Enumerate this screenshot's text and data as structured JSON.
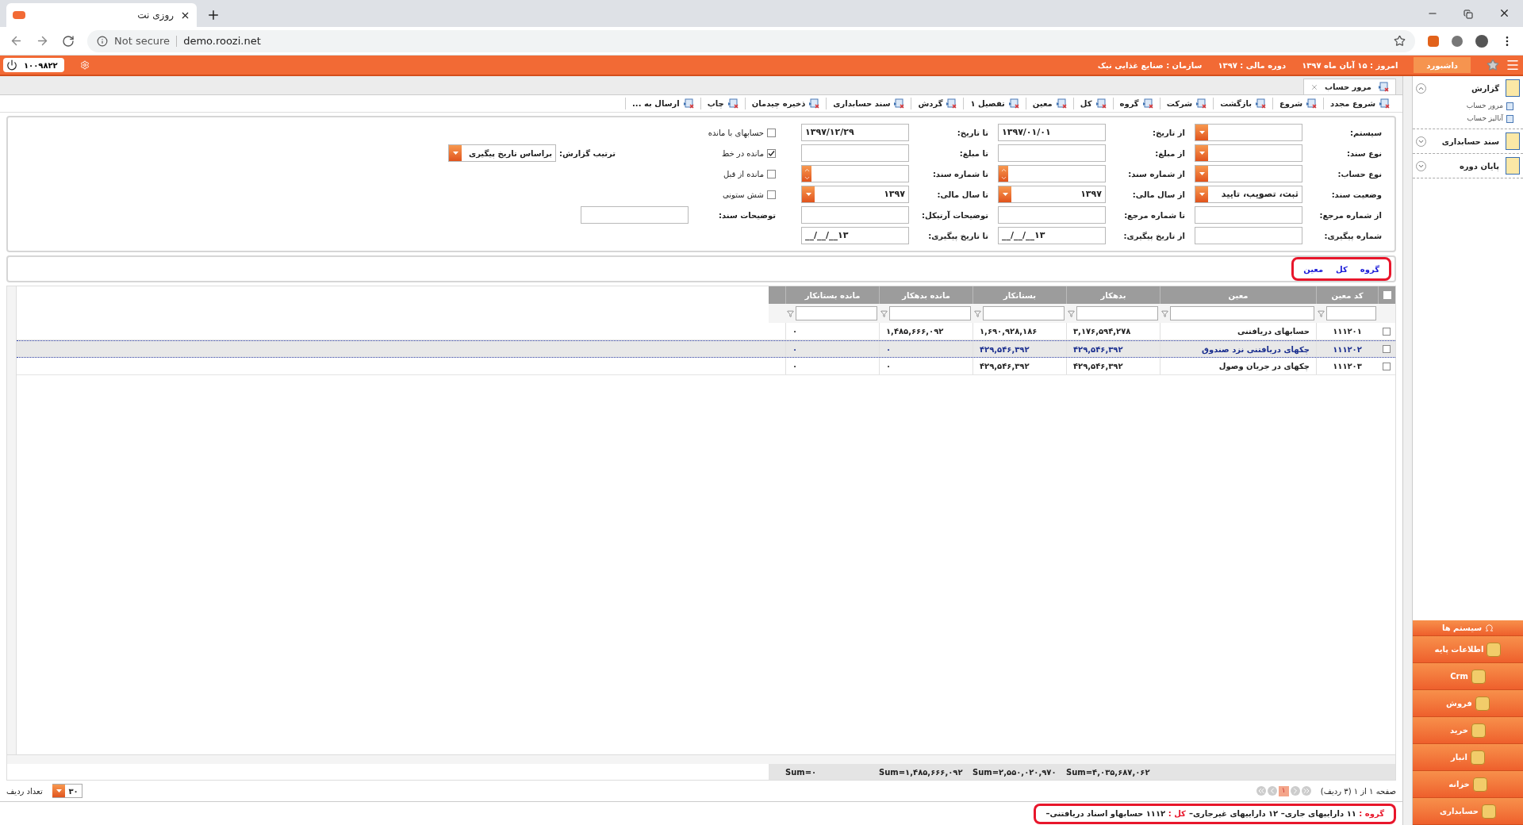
{
  "browser": {
    "tab_title": "روزی نت",
    "security": "Not secure",
    "url": "demo.roozi.net"
  },
  "top_bar": {
    "dashboard": "داشبورد",
    "today": "امروز : ۱۵ آبان ماه ۱۳۹۷",
    "fiscal": "دوره مالی : ۱۳۹۷",
    "org": "سازمان : صنایع غذایی نیک",
    "user_code": "۱۰۰۹۸۲۲"
  },
  "tabs": [
    {
      "label": "مرور حساب",
      "selected": true
    }
  ],
  "toolbar": [
    "شروع مجدد",
    "شروع",
    "بازگشت",
    "شرکت",
    "گروه",
    "کل",
    "معین",
    "تفصیل ۱",
    "گردش",
    "سند حسابداری",
    "ذخیره چیدمان",
    "چاپ",
    "ارسال به ..."
  ],
  "form": {
    "rows": [
      [
        {
          "kind": "select",
          "label": "سیستم:"
        },
        {
          "kind": "text",
          "label": "از تاریخ:",
          "value": "۱۳۹۷/۰۱/۰۱"
        },
        {
          "kind": "text",
          "label": "تا تاریخ:",
          "value": "۱۳۹۷/۱۲/۲۹"
        },
        {
          "kind": "checkbox",
          "label": "حسابهای با مانده",
          "checked": false
        }
      ],
      [
        {
          "kind": "select",
          "label": "نوع سند:"
        },
        {
          "kind": "text",
          "label": "از مبلغ:"
        },
        {
          "kind": "text",
          "label": "تا مبلغ:"
        },
        {
          "kind": "checkbox",
          "label": "مانده در خط",
          "checked": true
        }
      ],
      [
        {
          "kind": "select",
          "label": "نوع حساب:"
        },
        {
          "kind": "spin",
          "label": "از شماره سند:"
        },
        {
          "kind": "spin",
          "label": "تا شماره سند:"
        },
        {
          "kind": "checkbox",
          "label": "مانده از قبل",
          "checked": false
        }
      ],
      [
        {
          "kind": "select",
          "label": "وضعیت سند:",
          "value": "ثبت، تصویب، تایید"
        },
        {
          "kind": "select",
          "label": "از سال مالی:",
          "value": "۱۳۹۷"
        },
        {
          "kind": "select",
          "label": "تا سال مالی:",
          "value": "۱۳۹۷"
        },
        {
          "kind": "checkbox",
          "label": "شش ستونی",
          "checked": false
        }
      ],
      [
        {
          "kind": "text",
          "label": "از شماره مرجع:"
        },
        {
          "kind": "text",
          "label": "تا شماره مرجع:"
        },
        {
          "kind": "text",
          "label": "توضیحات آرتیکل:"
        },
        {
          "kind": "text",
          "label": "توضیحات سند:"
        }
      ],
      [
        {
          "kind": "text",
          "label": "شماره پیگیری:"
        },
        {
          "kind": "text",
          "label": "از تاریخ پیگیری:",
          "value": "__/__/__۱۳"
        },
        {
          "kind": "text",
          "label": "تا تاریخ پیگیری:",
          "value": "__/__/__۱۳"
        }
      ]
    ],
    "sort": {
      "label": "ترتیب گزارش:",
      "value": "براساس تاریخ پیگیری"
    }
  },
  "breadcrumb": [
    "گروه",
    "کل",
    "معین"
  ],
  "table": {
    "all_checked": false,
    "columns": [
      "کد معین",
      "معین",
      "بدهکار",
      "بستانکار",
      "مانده بدهکار",
      "مانده بستانکار"
    ],
    "rows": [
      {
        "selected": false,
        "checked": false,
        "cells": [
          "۱۱۱۲۰۱",
          "حسابهای دریافتنی",
          "۳,۱۷۶,۵۹۴,۲۷۸",
          "۱,۶۹۰,۹۲۸,۱۸۶",
          "۱,۴۸۵,۶۶۶,۰۹۲",
          "۰"
        ]
      },
      {
        "selected": true,
        "checked": false,
        "cells": [
          "۱۱۱۲۰۲",
          "چکهای دریافتنی نزد صندوق",
          "۴۲۹,۵۴۶,۳۹۲",
          "۴۲۹,۵۴۶,۳۹۲",
          "۰",
          "۰"
        ]
      },
      {
        "selected": false,
        "checked": false,
        "cells": [
          "۱۱۱۲۰۳",
          "چکهای در جریان وصول",
          "۴۲۹,۵۴۶,۳۹۲",
          "۴۲۹,۵۴۶,۳۹۲",
          "۰",
          "۰"
        ]
      }
    ],
    "sums": [
      "Sum=۴,۰۳۵,۶۸۷,۰۶۲",
      "Sum=۲,۵۵۰,۰۲۰,۹۷۰",
      "Sum=۱,۴۸۵,۶۶۶,۰۹۲",
      "Sum=۰"
    ]
  },
  "pagination": {
    "info": "صفحه ۱ از ۱ (۳ ردیف)",
    "pages": [
      {
        "label": "۱",
        "selected": true
      }
    ],
    "rows_label": "تعداد ردیف",
    "rows_value": "۳۰"
  },
  "status": [
    {
      "label": "گروه :",
      "text": "۱۱ داراییهای جاری– ۱۲ داراییهای غیرجاری–"
    },
    {
      "label": "کل :",
      "text": "۱۱۱۲ حسابهاو اسناد دریافتنی–"
    }
  ],
  "sidebar": {
    "sections": [
      {
        "label": "گزارش",
        "expanded": true,
        "items": [
          "مرور حساب",
          "آنالیز حساب"
        ]
      },
      {
        "label": "سند حسابداری",
        "expanded": false
      },
      {
        "label": "پایان دوره",
        "expanded": false
      }
    ],
    "modules": [
      "سیستم ها",
      "اطلاعات پایه",
      "Crm",
      "فروش",
      "خرید",
      "انبار",
      "خزانه",
      "حسابداری"
    ]
  }
}
